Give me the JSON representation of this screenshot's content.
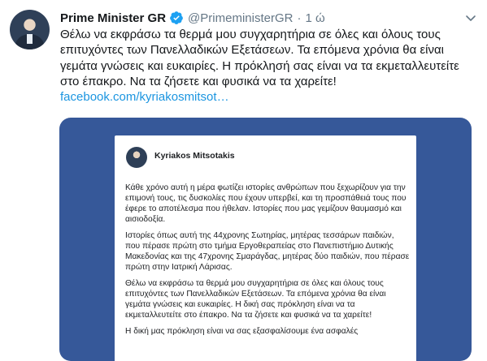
{
  "tweet": {
    "display_name": "Prime Minister GR",
    "handle": "@PrimeministerGR",
    "separator": "·",
    "time": "1 ώ",
    "text": "Θέλω να εκφράσω τα θερμά μου συγχαρητήρια σε όλες και όλους τους επιτυχόντες των Πανελλαδικών Εξετάσεων. Τα επόμενα χρόνια θα είναι γεμάτα γνώσεις και ευκαιρίες. Η πρόκλησή σας είναι να τα εκμεταλλευτείτε στο έπακρο. Να τα ζήσετε και φυσικά να τα χαρείτε!",
    "link_text": "facebook.com/kyriakosmitsot…",
    "avatar_icon": "profile-photo",
    "verified_icon": "verified-badge-icon",
    "menu_icon": "chevron-down-icon"
  },
  "card": {
    "background_color": "#365899",
    "author": "Kyriakos Mitsotakis",
    "paragraphs": [
      "Κάθε χρόνο αυτή η μέρα φωτίζει ιστορίες ανθρώπων που ξεχωρίζουν για την επιμονή τους, τις δυσκολίες που έχουν υπερβεί, και τη προσπάθειά τους που έφερε το αποτέλεσμα που ήθελαν. Ιστορίες που μας γεμίζουν θαυμασμό και αισιοδοξία.",
      "Ιστορίες όπως αυτή της 44χρονης Σωτηρίας, μητέρας τεσσάρων παιδιών, που πέρασε πρώτη στο τμήμα Εργοθεραπείας στο Πανεπιστήμιο Δυτικής Μακεδονίας και της 47χρονης Σμαράγδας, μητέρας δύο παιδιών, που πέρασε πρώτη στην Ιατρική Λάρισας.",
      "Θέλω να εκφράσω τα θερμά μου συγχαρητήρια σε όλες και όλους τους επιτυχόντες των Πανελλαδικών Εξετάσεων. Τα επόμενα χρόνια θα είναι γεμάτα γνώσεις και ευκαιρίες. Η δική σας πρόκληση είναι να τα εκμεταλλευτείτε στο έπακρο. Να τα ζήσετε και φυσικά να τα χαρείτε!",
      "Η δική μας πρόκληση είναι να σας εξασφαλίσουμε ένα ασφαλές"
    ]
  }
}
